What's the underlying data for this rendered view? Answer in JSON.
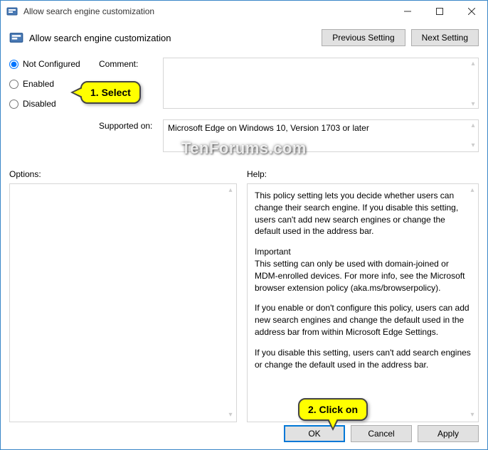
{
  "window": {
    "title": "Allow search engine customization"
  },
  "header": {
    "title": "Allow search engine customization",
    "prev": "Previous Setting",
    "next": "Next Setting"
  },
  "radios": {
    "not_configured": "Not Configured",
    "enabled": "Enabled",
    "disabled": "Disabled"
  },
  "labels": {
    "comment": "Comment:",
    "supported": "Supported on:",
    "options": "Options:",
    "help": "Help:"
  },
  "fields": {
    "comment": "",
    "supported": "Microsoft Edge on Windows 10, Version 1703 or later"
  },
  "help": {
    "p1": "This policy setting lets you decide whether users can change their search engine. If you disable this setting, users can't add new search engines or change the default used in the address bar.",
    "p2a": "Important",
    "p2b": "This setting can only be used with domain-joined or MDM-enrolled devices. For more info, see the Microsoft browser extension policy (aka.ms/browserpolicy).",
    "p3": "If you enable or don't configure this policy, users can add new search engines and change the default used in the address bar from within Microsoft Edge Settings.",
    "p4": "If you disable this setting, users can't add search engines or change the default used in the address bar."
  },
  "footer": {
    "ok": "OK",
    "cancel": "Cancel",
    "apply": "Apply"
  },
  "callouts": {
    "select": "1. Select",
    "click": "2. Click on"
  },
  "watermark": "TenForums.com"
}
